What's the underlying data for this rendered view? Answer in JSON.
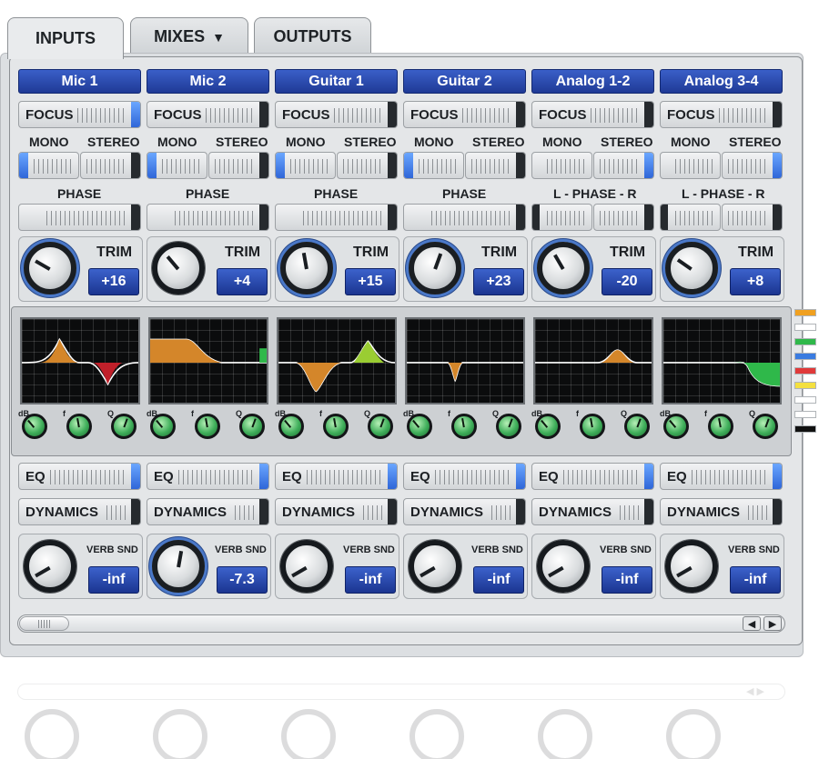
{
  "tabs": [
    {
      "label": "INPUTS",
      "active": true
    },
    {
      "label": "MIXES",
      "has_dropdown": true
    },
    {
      "label": "OUTPUTS"
    }
  ],
  "labels": {
    "focus": "FOCUS",
    "mono": "MONO",
    "stereo": "STEREO",
    "phase": "PHASE",
    "lr_phase": "L - PHASE - R",
    "trim": "TRIM",
    "eq": "EQ",
    "dynamics": "DYNAMICS",
    "verb_snd": "VERB SND",
    "eq_knob_symbols": [
      "dB",
      "f",
      "Q"
    ]
  },
  "channels": [
    {
      "name": "Mic 1",
      "trim": "+16",
      "verb": "-inf",
      "stereo_link": false
    },
    {
      "name": "Mic 2",
      "trim": "+4",
      "verb": "-7.3",
      "stereo_link": false
    },
    {
      "name": "Guitar 1",
      "trim": "+15",
      "verb": "-inf",
      "stereo_link": false
    },
    {
      "name": "Guitar 2",
      "trim": "+23",
      "verb": "-inf",
      "stereo_link": false
    },
    {
      "name": "Analog 1-2",
      "trim": "-20",
      "verb": "-inf",
      "stereo_link": true
    },
    {
      "name": "Analog 3-4",
      "trim": "+8",
      "verb": "-inf",
      "stereo_link": true
    }
  ],
  "colors": {
    "accent_blue": "#2f66d8",
    "eq_orange": "#d4862a",
    "eq_red": "#c0202a",
    "eq_lime": "#9acd32",
    "eq_green": "#2fb84a",
    "knob_green": "#3fae5a"
  },
  "bus_tags": [
    "#f0a020",
    "#ffffff",
    "#2fb84a",
    "#3a7be0",
    "#e03a3a",
    "#f4e040",
    "#ffffff",
    "#ffffff",
    "#111111"
  ],
  "scroll": {
    "left_arrow": "◀",
    "right_arrow": "▶"
  }
}
